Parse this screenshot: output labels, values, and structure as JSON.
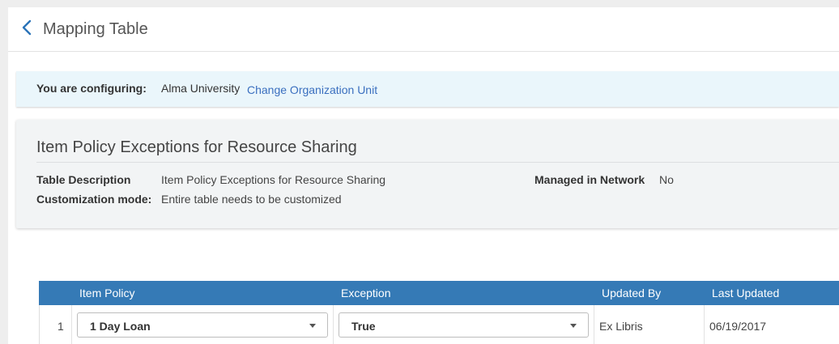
{
  "header": {
    "title": "Mapping Table"
  },
  "config": {
    "label": "You are configuring:",
    "org": "Alma University",
    "change_link": "Change Organization Unit"
  },
  "info": {
    "title": "Item Policy Exceptions for Resource Sharing",
    "description_label": "Table Description",
    "description_value": "Item Policy Exceptions for Resource Sharing",
    "mode_label": "Customization mode:",
    "mode_value": "Entire table needs to be customized",
    "network_label": "Managed in Network",
    "network_value": "No"
  },
  "table": {
    "columns": [
      "Item Policy",
      "Exception",
      "Updated By",
      "Last Updated"
    ],
    "rows": [
      {
        "number": "1",
        "item_policy": "1 Day Loan",
        "exception": "True",
        "updated_by": "Ex Libris",
        "last_updated": "06/19/2017"
      }
    ]
  }
}
